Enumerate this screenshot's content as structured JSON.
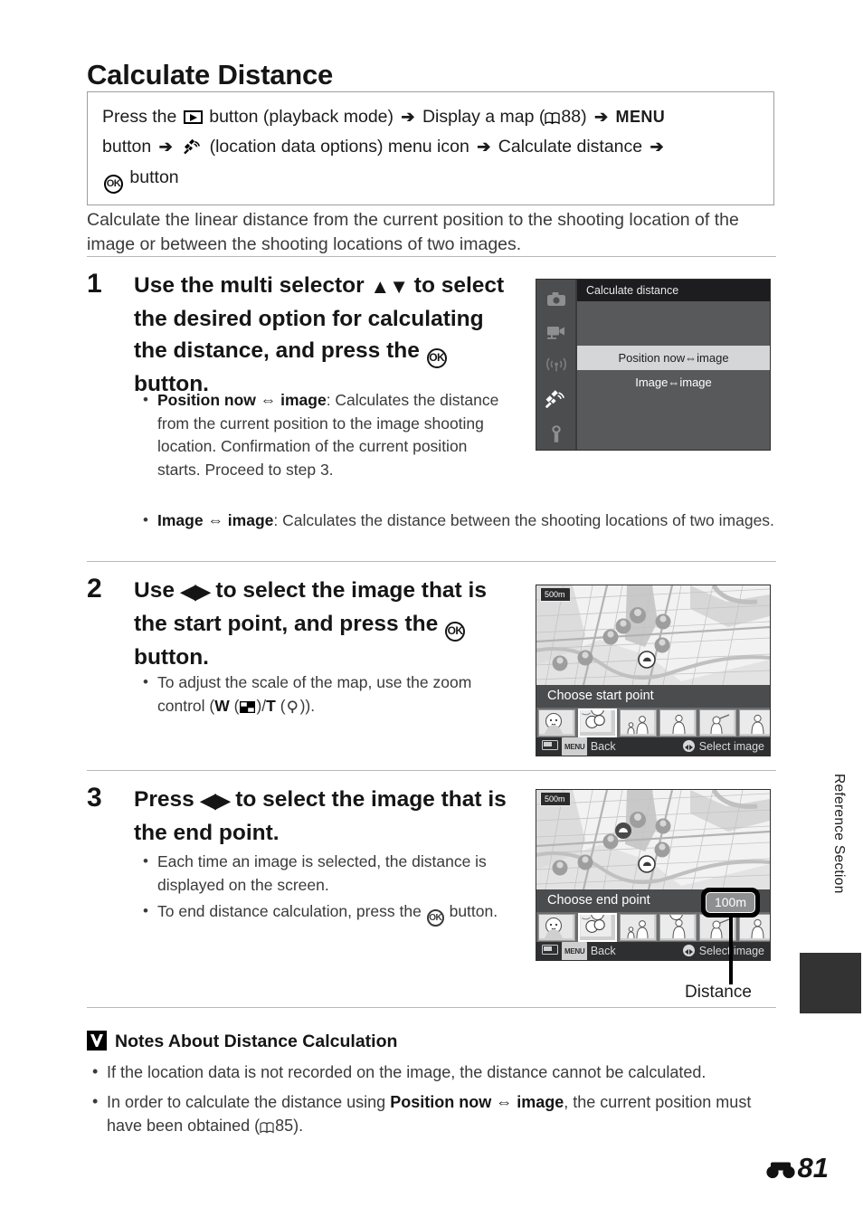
{
  "page": {
    "title": "Calculate Distance",
    "page_number": "81",
    "side_tab_label": "Reference Section"
  },
  "nav_path": {
    "line1_a": "Press the",
    "play_icon": "play-button-icon",
    "line1_b": "button (playback mode)",
    "line1_c": "Display a map (",
    "ref1": "88",
    "line1_d": ")",
    "menu_word": "MENU",
    "line2_a": "button",
    "sat_icon": "satellite-icon",
    "line2_b": "(location data options) menu icon",
    "line2_c": "Calculate distance",
    "ok_label": "OK",
    "line3": "button",
    "arrow": "➔"
  },
  "intro": "Calculate the linear distance from the current position to the shooting location of the image or between the shooting locations of two images.",
  "steps": [
    {
      "num": "1",
      "heading_a": "Use the multi selector",
      "heading_arrows": "▲▼",
      "heading_b": "to select the desired option for calculating the distance, and press the",
      "heading_c": "button.",
      "bullets": [
        {
          "bold": "Position now ⇔ image",
          "rest": ": Calculates the distance from the current position to the image shooting location. Confirmation of the current position starts. Proceed to step 3."
        },
        {
          "bold": "Image ⇔ image",
          "rest": ": Calculates the distance between the shooting locations of two images."
        }
      ]
    },
    {
      "num": "2",
      "heading_a": "Use",
      "heading_arrows": "◀▶",
      "heading_b": "to select the image that is the start point, and press the",
      "heading_c": "button.",
      "bullets": [
        {
          "bold": "",
          "rest": "To adjust the scale of the map, use the zoom control ("
        }
      ],
      "zoom_hint": {
        "w_label": "W",
        "thumbnail_icon": "thumbnail-view-icon",
        "slash": "/",
        "t_label": "T",
        "magnify_icon": "magnify-icon",
        "tail": "))."
      }
    },
    {
      "num": "3",
      "heading_a": "Press",
      "heading_arrows": "◀▶",
      "heading_b": "to select the image that is the end point.",
      "bullets": [
        {
          "bold": "",
          "rest": "Each time an image is selected, the distance is displayed on the screen."
        },
        {
          "bold": "",
          "rest": "To end distance calculation, press the"
        }
      ],
      "bullet2_tail": "button."
    }
  ],
  "menu_screen": {
    "title": "Calculate distance",
    "sidebar_icons": [
      "shooting-menu-camera-icon",
      "movie-menu-icon",
      "wireless-menu-icon",
      "location-data-options-icon",
      "setup-menu-wrench-icon",
      "battery-icon"
    ],
    "options": [
      {
        "label": "Position now⇔image",
        "selected": true
      },
      {
        "label": "Image⇔image",
        "selected": false
      }
    ]
  },
  "map_screen_start": {
    "scale": "500m",
    "caption": "Choose start point",
    "back_label": "Back",
    "select_label": "Select image",
    "menu_chip": "MENU",
    "thumbnail_count": 6,
    "highlighted_thumbnail": 2,
    "next_arrow": "▶"
  },
  "map_screen_end": {
    "scale": "500m",
    "caption": "Choose end point",
    "back_label": "Back",
    "select_label": "Select image",
    "menu_chip": "MENU",
    "distance_value": "100m",
    "distance_callout_label": "Distance",
    "thumbnail_count": 6,
    "highlighted_thumbnail": 2,
    "next_arrow": "▶"
  },
  "notes": {
    "heading": "Notes About Distance Calculation",
    "items": [
      {
        "pre": "If the location data is not recorded on the image, the distance cannot be calculated.",
        "bold": "",
        "post": ""
      },
      {
        "pre": "In order to calculate the distance using ",
        "bold": "Position now ⇔ image",
        "post": ", the current position must have been obtained (",
        "ref": "85",
        "tail": ")."
      }
    ]
  }
}
